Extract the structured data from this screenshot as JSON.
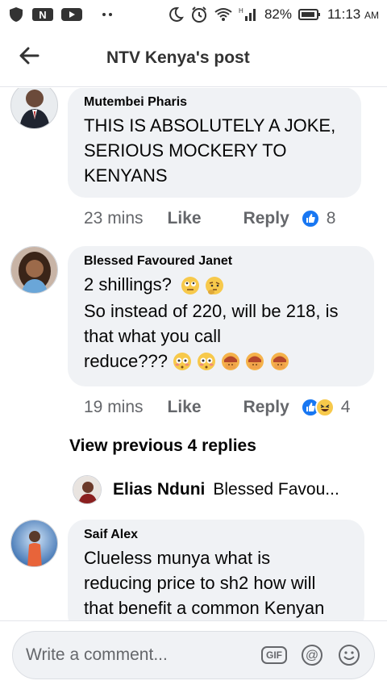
{
  "status_bar": {
    "battery_percent": "82%",
    "time": "11:13",
    "ampm": "AM",
    "icons": [
      "shield-icon",
      "n-icon",
      "video-icon",
      "dots-icon",
      "moon-icon",
      "alarm-icon",
      "wifi-icon",
      "signal-icon",
      "battery-icon"
    ]
  },
  "header": {
    "title": "NTV Kenya's post",
    "back_icon": "back-arrow-icon"
  },
  "comments": [
    {
      "author": "Mutembei Pharis",
      "lines": [
        "THIS IS ABSOLUTELY A JOKE,",
        "SERIOUS MOCKERY TO",
        "KENYANS"
      ],
      "time": "23 mins",
      "like_label": "Like",
      "reply_label": "Reply",
      "reaction_count": "8",
      "reactions": [
        "like"
      ]
    },
    {
      "author": "Blessed Favoured Janet",
      "line1": "2 shillings?",
      "line2": "So instead of 220, will be 218, is",
      "line3": "that what you call",
      "line4": "reduce???",
      "emojis_line1": [
        "rolling-eyes-emoji",
        "thinking-emoji"
      ],
      "emojis_line4": [
        "flushed-emoji",
        "flushed-emoji",
        "facepalm-emoji",
        "facepalm-emoji",
        "facepalm-emoji"
      ],
      "time": "19 mins",
      "like_label": "Like",
      "reply_label": "Reply",
      "reaction_count": "4",
      "reactions": [
        "like",
        "haha"
      ]
    },
    {
      "author": "Saif Alex",
      "lines": [
        "Clueless munya what is",
        "reducing price to sh2 how will",
        "that benefit a common Kenyan"
      ]
    }
  ],
  "view_previous": "View previous 4 replies",
  "reply_preview": {
    "name": "Elias Nduni",
    "snippet": "Blessed Favou..."
  },
  "composer": {
    "placeholder": "Write a comment...",
    "gif_label": "GIF",
    "at_label": "@"
  },
  "colors": {
    "like_blue": "#1877f2",
    "bubble_gray": "#f0f2f5",
    "meta_gray": "#65676b"
  }
}
